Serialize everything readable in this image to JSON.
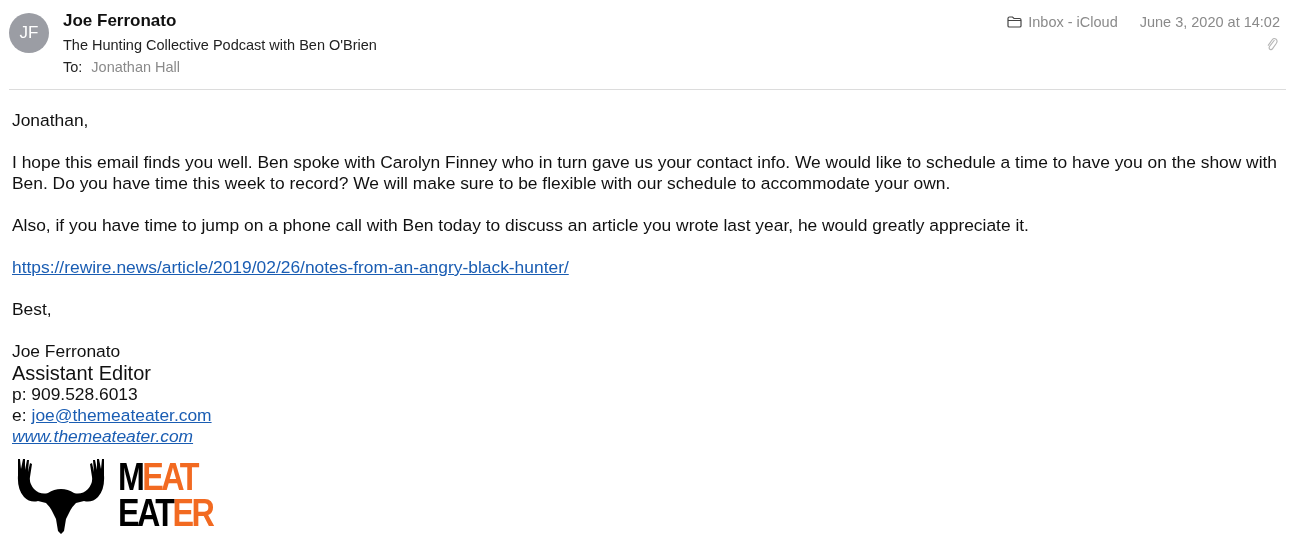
{
  "header": {
    "avatar_initials": "JF",
    "sender": "Joe Ferronato",
    "subject": "The Hunting Collective Podcast with Ben O'Brien",
    "to_label": "To:",
    "recipient": "Jonathan Hall",
    "mailbox": "Inbox - iCloud",
    "date": "June 3, 2020 at 14:02",
    "has_attachment": true
  },
  "body": {
    "greeting": "Jonathan,",
    "paragraphs": [
      "I hope this email finds you well. Ben spoke with Carolyn Finney who in turn gave us your contact info. We would like to schedule a time to have you on the show with Ben. Do you have time this week to record? We will make sure to be flexible with our schedule to accommodate your own.",
      "Also, if you have time to jump on a phone call with Ben today to discuss an article you wrote last year, he would greatly appreciate it."
    ],
    "article_link": "https://rewire.news/article/2019/02/26/notes-from-an-angry-black-hunter/",
    "closing": "Best,"
  },
  "signature": {
    "name": "Joe Ferronato",
    "title": "Assistant Editor",
    "phone": "p: 909.528.6013",
    "email_label": "e:",
    "email": "joe@themeateater.com",
    "website": "www.themeateater.com",
    "logo": [
      [
        {
          "text": "M",
          "accent": false
        },
        {
          "text": "EAT",
          "accent": true
        }
      ],
      [
        {
          "text": "EAT",
          "accent": false
        },
        {
          "text": "ER",
          "accent": true
        }
      ]
    ]
  }
}
